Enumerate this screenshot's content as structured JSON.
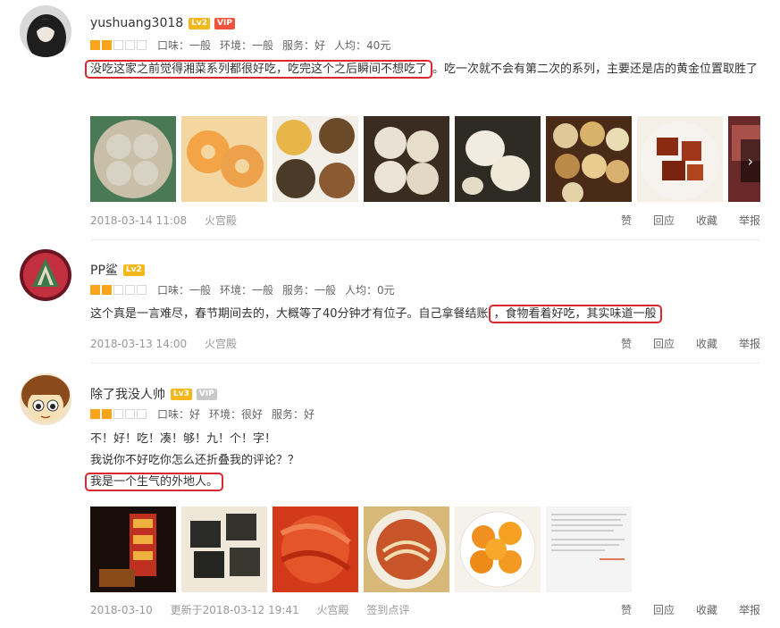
{
  "reviews": [
    {
      "username": "yushuang3018",
      "level": "Lv2",
      "vip": "VIP",
      "stars": 2,
      "meta": [
        "口味：一般",
        "环境：一般",
        "服务：好",
        "人均：40元"
      ],
      "text_highlight": "没吃这家之前觉得湘菜系列都很好吃，吃完这个之后瞬间不想吃了",
      "text_rest": "。吃一次就不会有第二次的系列，主要还是店的黄金位置取胜了",
      "date": "2018-03-14 11:08",
      "shop": "火宫殿",
      "actions": [
        "赞",
        "回应",
        "收藏",
        "举报"
      ]
    },
    {
      "username": "PP鲨",
      "level": "Lv2",
      "stars": 2,
      "meta": [
        "口味：一般",
        "环境：一般",
        "服务：一般",
        "人均：0元"
      ],
      "text_before": "这个真是一言难尽，春节期间去的，大概等了40分钟才有位子。自己拿餐结账",
      "text_highlight": "，食物看着好吃，其实味道一般",
      "date": "2018-03-13 14:00",
      "shop": "火宫殿",
      "actions": [
        "赞",
        "回应",
        "收藏",
        "举报"
      ]
    },
    {
      "username": "除了我没人帅",
      "level": "Lv3",
      "vip": "VIP",
      "stars": 2,
      "meta": [
        "口味：好",
        "环境：很好",
        "服务：好"
      ],
      "line1": "不！好！吃！凑！够！九！个！字！",
      "line2": "我说你不好吃你怎么还折叠我的评论？？",
      "line3_highlight": "我是一个生气的外地人。",
      "date": "2018-03-10",
      "updated": "更新于2018-03-12 19:41",
      "shop": "火宫殿",
      "checkin": "签到点评",
      "actions": [
        "赞",
        "回应",
        "收藏",
        "举报"
      ]
    }
  ],
  "icons": {
    "next": "chevron-right-icon"
  },
  "colors": {
    "highlight": "#d9282f",
    "star": "#f8a51b",
    "level": "#f5b81c",
    "vip": "#f0533b"
  }
}
